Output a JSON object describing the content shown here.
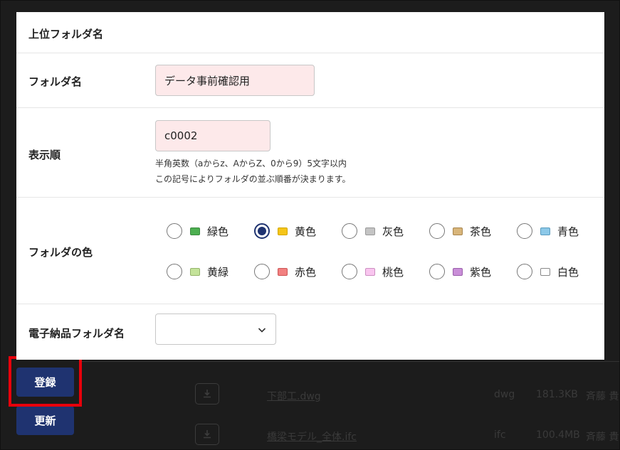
{
  "background": {
    "rows": [
      {
        "name": "下部工.dwg",
        "ext": "dwg",
        "size": "181.3KB",
        "user": "斉藤 貴"
      },
      {
        "name": "橋梁モデル_全体.ifc",
        "ext": "ifc",
        "size": "100.4MB",
        "user": "斉藤 貴"
      }
    ],
    "buttons": {
      "register": "登録",
      "update": "更新"
    }
  },
  "modal": {
    "parent_folder_label": "上位フォルダ名",
    "folder_name_label": "フォルダ名",
    "folder_name_value": "データ事前確認用",
    "display_order_label": "表示順",
    "display_order_value": "c0002",
    "display_order_help1": "半角英数（aからz、AからZ、0から9）5文字以内",
    "display_order_help2": "この記号によりフォルダの並ぶ順番が決まります。",
    "folder_color_label": "フォルダの色",
    "colors": [
      {
        "label": "緑色",
        "swatch": "#4caf50",
        "border": "#3b8a3f",
        "checked": false
      },
      {
        "label": "黄色",
        "swatch": "#f5c518",
        "border": "#d3a700",
        "checked": true
      },
      {
        "label": "灰色",
        "swatch": "#c4c4c4",
        "border": "#999999",
        "checked": false
      },
      {
        "label": "茶色",
        "swatch": "#d8b57a",
        "border": "#a8854e",
        "checked": false
      },
      {
        "label": "青色",
        "swatch": "#8cc8e8",
        "border": "#5a9cbf",
        "checked": false
      },
      {
        "label": "黄緑",
        "swatch": "#c4e39a",
        "border": "#94b46a",
        "checked": false
      },
      {
        "label": "赤色",
        "swatch": "#f28080",
        "border": "#cc5555",
        "checked": false
      },
      {
        "label": "桃色",
        "swatch": "#f9c5ef",
        "border": "#cc8fc1",
        "checked": false
      },
      {
        "label": "紫色",
        "swatch": "#c98ed8",
        "border": "#9a5fab",
        "checked": false
      },
      {
        "label": "白色",
        "swatch": "#ffffff",
        "border": "#888888",
        "checked": false
      }
    ],
    "electronic_folder_label": "電子納品フォルダ名",
    "electronic_folder_value": ""
  },
  "accent_color": "#1f3370",
  "highlight_color": "#e8000b"
}
